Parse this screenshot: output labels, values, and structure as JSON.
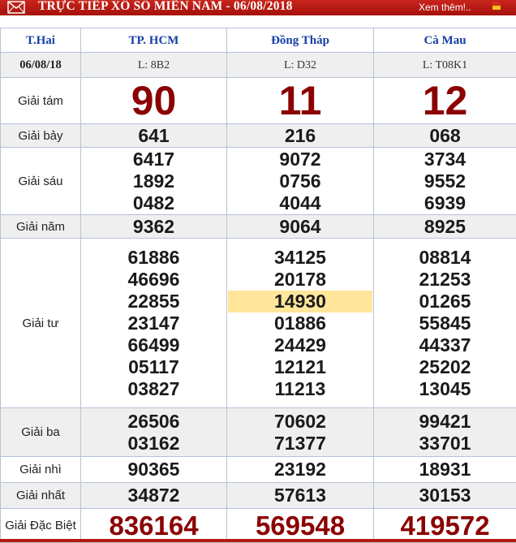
{
  "header": {
    "title": "TRỰC TIẾP XỔ SỐ MIỀN NAM - 06/08/2018",
    "more_link": "Xem thêm!..",
    "icons": {
      "mail": "mail-icon",
      "flag": "flag-icon"
    },
    "colors": {
      "bar": "#b5160f",
      "prize_highlight": "#8b0000",
      "province": "#1540a5",
      "highlight_cell": "#ffe69b"
    }
  },
  "table": {
    "day": "T.Hai",
    "date": "06/08/18",
    "provinces": [
      {
        "name": "TP. HCM",
        "code": "L: 8B2"
      },
      {
        "name": "Đồng Tháp",
        "code": "L: D32"
      },
      {
        "name": "Cà Mau",
        "code": "L: T08K1"
      }
    ],
    "prizes": [
      {
        "label": "Giải tám",
        "results": [
          [
            "90"
          ],
          [
            "11"
          ],
          [
            "12"
          ]
        ]
      },
      {
        "label": "Giải bảy",
        "results": [
          [
            "641"
          ],
          [
            "216"
          ],
          [
            "068"
          ]
        ]
      },
      {
        "label": "Giải sáu",
        "results": [
          [
            "6417",
            "1892",
            "0482"
          ],
          [
            "9072",
            "0756",
            "4044"
          ],
          [
            "3734",
            "9552",
            "6939"
          ]
        ]
      },
      {
        "label": "Giải năm",
        "results": [
          [
            "9362"
          ],
          [
            "9064"
          ],
          [
            "8925"
          ]
        ]
      },
      {
        "label": "Giải tư",
        "results": [
          [
            "61886",
            "46696",
            "22855",
            "23147",
            "66499",
            "05117",
            "03827"
          ],
          [
            "34125",
            "20178",
            "14930",
            "01886",
            "24429",
            "12121",
            "11213"
          ],
          [
            "08814",
            "21253",
            "01265",
            "55845",
            "44337",
            "25202",
            "13045"
          ]
        ]
      },
      {
        "label": "Giải ba",
        "results": [
          [
            "26506",
            "03162"
          ],
          [
            "70602",
            "71377"
          ],
          [
            "99421",
            "33701"
          ]
        ]
      },
      {
        "label": "Giải nhì",
        "results": [
          [
            "90365"
          ],
          [
            "23192"
          ],
          [
            "18931"
          ]
        ]
      },
      {
        "label": "Giải nhất",
        "results": [
          [
            "34872"
          ],
          [
            "57613"
          ],
          [
            "30153"
          ]
        ]
      },
      {
        "label": "Giải Đặc Biệt",
        "results": [
          [
            "836164"
          ],
          [
            "569548"
          ],
          [
            "419572"
          ]
        ]
      }
    ],
    "highlighted": {
      "province": "Đồng Tháp",
      "prize": "Giải tư",
      "value": "14930"
    }
  }
}
